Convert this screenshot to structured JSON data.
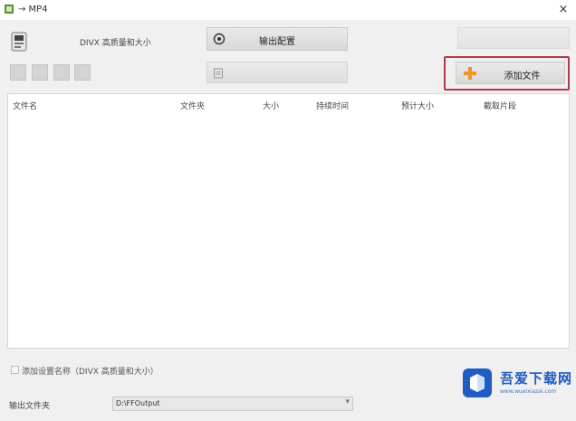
{
  "window": {
    "title": "→ MP4",
    "close_glyph": "×"
  },
  "toolbar": {
    "profile_label": "DIVX 高质量和大小",
    "output_config_label": "输出配置",
    "add_file_label": "添加文件",
    "icons": [
      "app-icon",
      "logo-icon",
      "settings-icon",
      "document-icon",
      "plus-icon",
      "chevron-down-icon"
    ]
  },
  "table": {
    "columns": [
      {
        "label": "文件名"
      },
      {
        "label": "文件夾"
      },
      {
        "label": "大小"
      },
      {
        "label": "持续时间"
      },
      {
        "label": "预计大小"
      },
      {
        "label": "截取片段"
      }
    ]
  },
  "options": {
    "checkbox_label": "添加设置名称（DIVX 高质量和大小）",
    "checked": false
  },
  "output": {
    "folder_label": "输出文件夹",
    "folder_value": "D:\\FFOutput"
  },
  "watermark": {
    "title": "吾爱下载网",
    "url": "www.wuaixiazai.com"
  },
  "colors": {
    "highlight": "#b03a4a",
    "watermark_blue": "#1f5cc4",
    "accent_orange": "#f0932b"
  }
}
